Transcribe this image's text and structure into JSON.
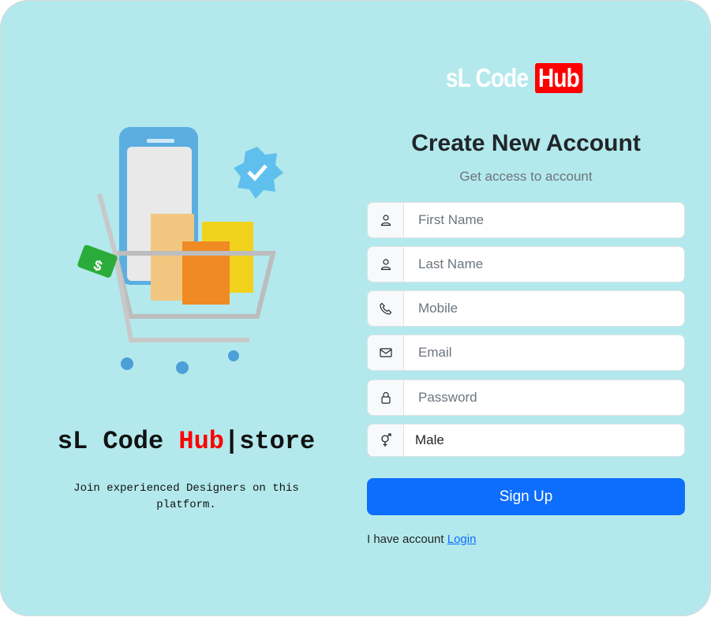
{
  "left": {
    "brand_prefix": "sL Code ",
    "brand_hub": "Hub",
    "brand_suffix": "|store",
    "tagline": "Join experienced Designers on this platform."
  },
  "logo": {
    "prefix": "sL Code",
    "hub": "Hub"
  },
  "form": {
    "title": "Create New Account",
    "subtitle": "Get access to account",
    "fields": [
      {
        "icon": "user-icon",
        "placeholder": "First Name",
        "value": ""
      },
      {
        "icon": "user-icon",
        "placeholder": "Last Name",
        "value": ""
      },
      {
        "icon": "phone-icon",
        "placeholder": "Mobile",
        "value": ""
      },
      {
        "icon": "envelope-icon",
        "placeholder": "Email",
        "value": ""
      },
      {
        "icon": "lock-icon",
        "placeholder": "Password",
        "value": ""
      }
    ],
    "gender": {
      "icon": "gender-icon",
      "value": "Male"
    },
    "signup_label": "Sign Up",
    "account_text": "I have account",
    "login_label": "Login"
  },
  "colors": {
    "bg": "#b3e9ec",
    "accent": "#0d6efd",
    "hub": "#ff0000"
  }
}
